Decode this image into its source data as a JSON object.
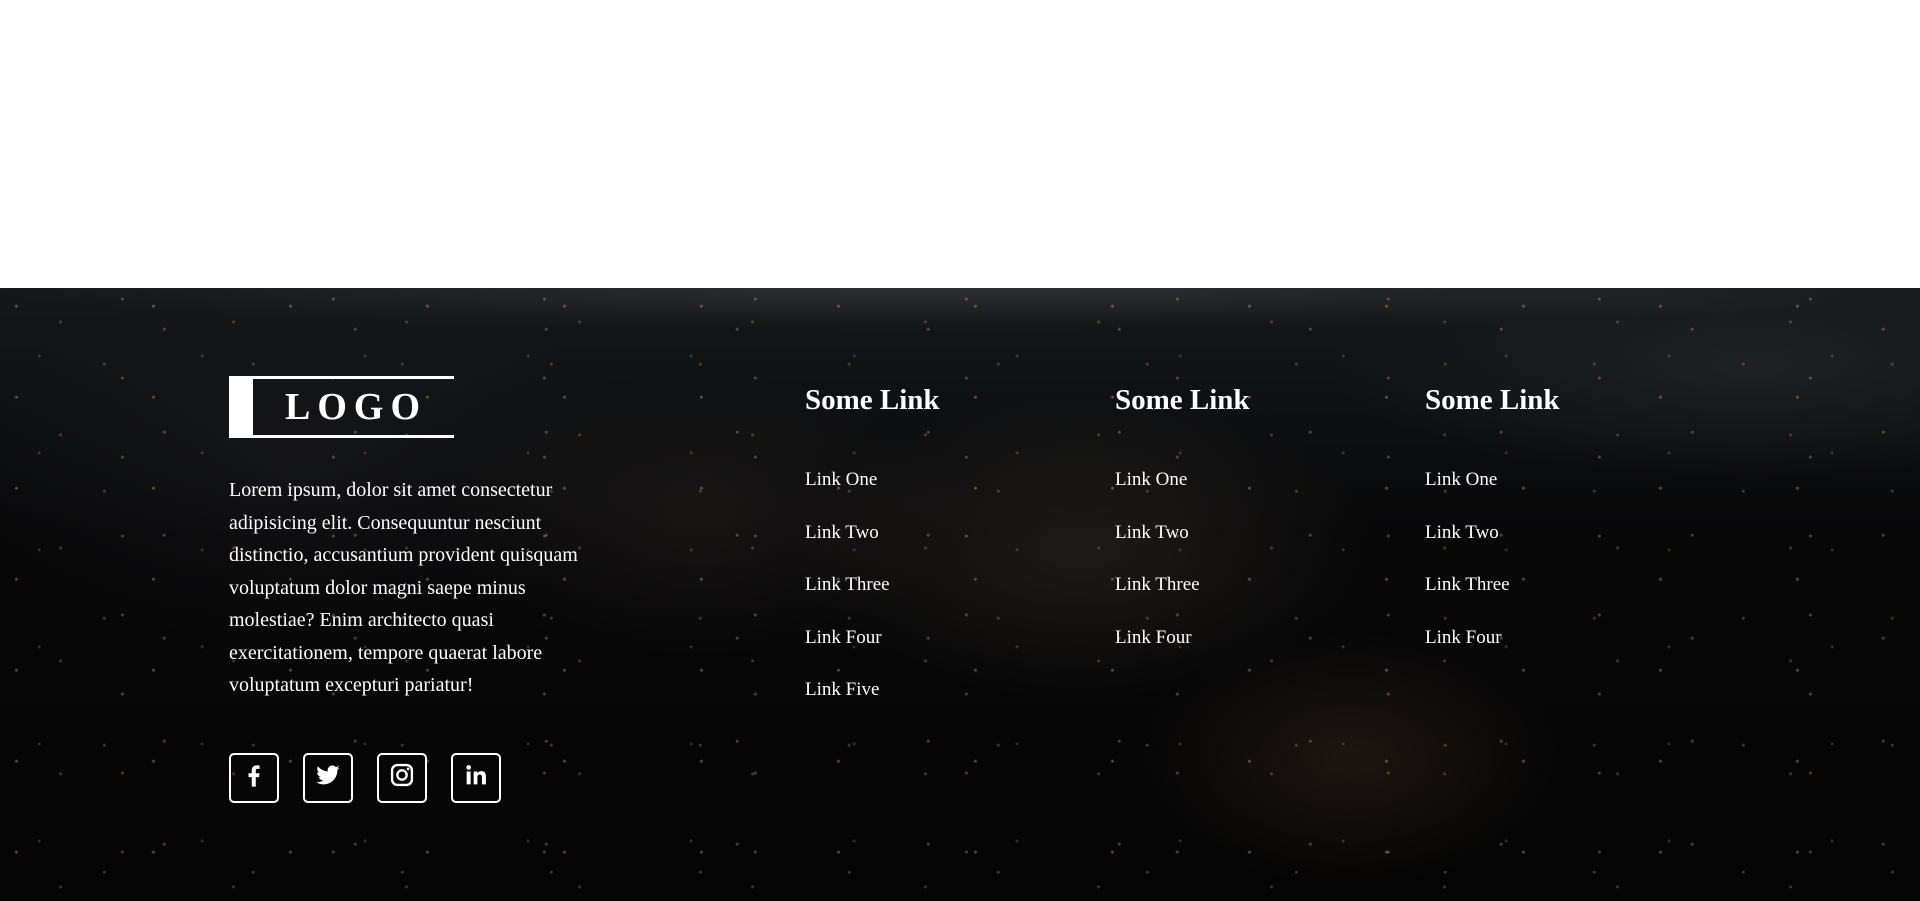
{
  "logo": {
    "text": "LOGO"
  },
  "about": {
    "text": "Lorem ipsum, dolor sit amet consectetur adipisicing elit. Consequuntur nesciunt distinctio, accusantium provident quisquam voluptatum dolor magni saepe minus molestiae? Enim architecto quasi exercitationem, tempore quaerat labore voluptatum excepturi pariatur!"
  },
  "socials": [
    {
      "icon": "facebook-icon"
    },
    {
      "icon": "twitter-icon"
    },
    {
      "icon": "instagram-icon"
    },
    {
      "icon": "linkedin-icon"
    }
  ],
  "columns": [
    {
      "title": "Some Link",
      "links": [
        "Link One",
        "Link Two",
        "Link Three",
        "Link Four",
        "Link Five"
      ]
    },
    {
      "title": "Some Link",
      "links": [
        "Link One",
        "Link Two",
        "Link Three",
        "Link Four"
      ]
    },
    {
      "title": "Some Link",
      "links": [
        "Link One",
        "Link Two",
        "Link Three",
        "Link Four"
      ]
    }
  ],
  "colors": {
    "page_background": "#ffffff",
    "footer_background": "#050505",
    "footer_text": "#ffffff"
  }
}
